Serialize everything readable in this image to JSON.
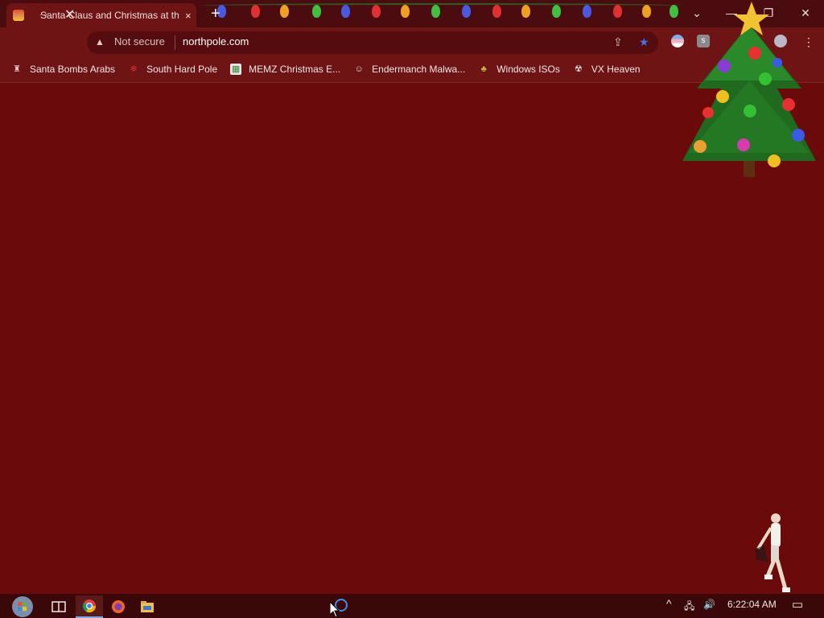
{
  "browser": {
    "tab": {
      "title": "Santa Claus and Christmas at the North Pole",
      "close_label": "×"
    },
    "new_tab_label": "+",
    "tab_search_label": "⌄",
    "window": {
      "minimize": "—",
      "restore": "❐",
      "close": "✕"
    },
    "nav": {
      "back": "←",
      "forward": "→",
      "stop": "✕"
    },
    "omnibox": {
      "warning_icon": "▲",
      "security": "Not secure",
      "url": "northpole.com",
      "share_icon": "⇪",
      "star_icon": "★"
    },
    "menu_icon": "⋮",
    "bookmarks": [
      {
        "label": "Santa Bombs Arabs",
        "icon": "santa-icon"
      },
      {
        "label": "South Hard Pole",
        "icon": "snowflake-icon"
      },
      {
        "label": "MEMZ Christmas E...",
        "icon": "image-icon"
      },
      {
        "label": "Endermanch Malwa...",
        "icon": "raccoon-icon"
      },
      {
        "label": "Windows ISOs",
        "icon": "tree-icon"
      },
      {
        "label": "VX Heaven",
        "icon": "vx-icon"
      }
    ]
  },
  "taskbar": {
    "clock": "6:22:04 AM",
    "chevron": "^",
    "network_icon": "🖧",
    "volume_icon": "🔊",
    "notifications_icon": "▭"
  },
  "colors": {
    "page_bg": "#6a0a0a",
    "toolbar_bg": "#6e1414",
    "accent_star": "#3d78e8"
  }
}
